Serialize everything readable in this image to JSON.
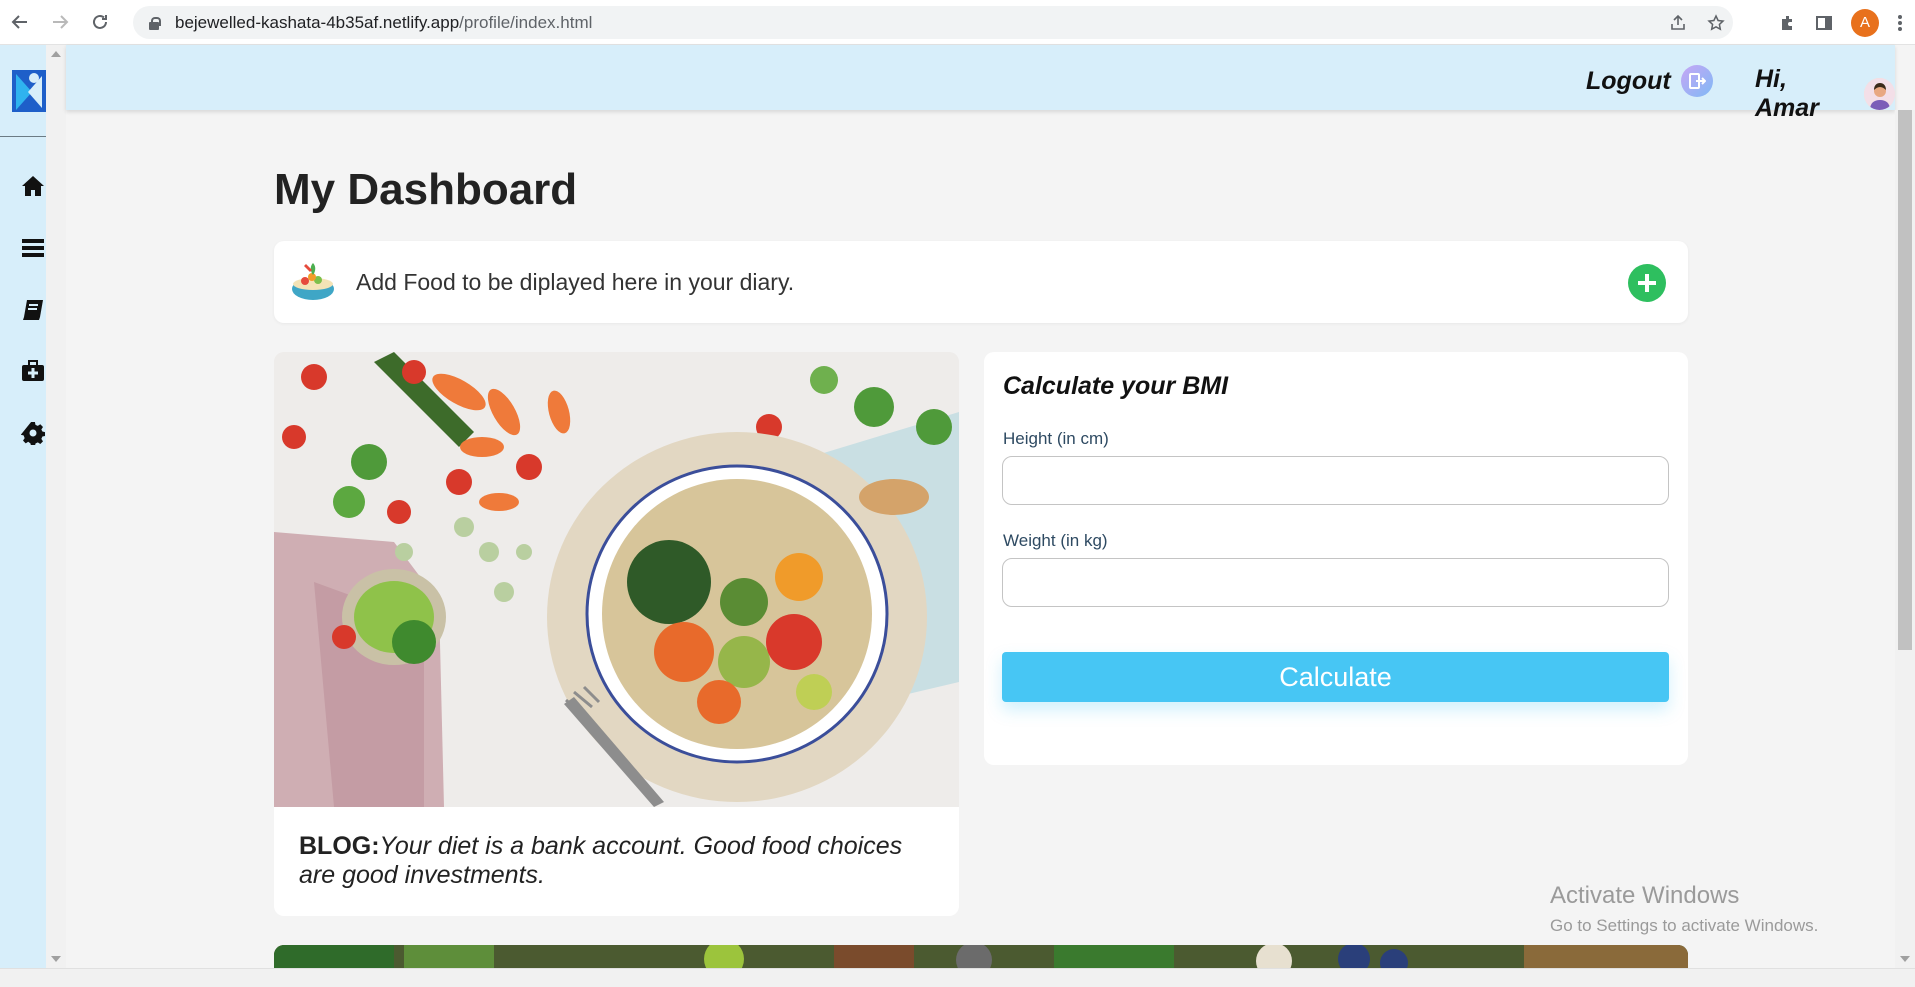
{
  "browser": {
    "url_host": "bejewelled-kashata-4b35af.netlify.app",
    "url_path": "/profile/index.html",
    "profile_initial": "A"
  },
  "header": {
    "logout_label": "Logout",
    "greeting": "Hi, Amar"
  },
  "sidebar": {
    "items": [
      {
        "name": "home",
        "icon": "home-icon"
      },
      {
        "name": "menu",
        "icon": "menu-icon"
      },
      {
        "name": "diary",
        "icon": "book-icon"
      },
      {
        "name": "medical",
        "icon": "medical-kit-icon"
      },
      {
        "name": "settings",
        "icon": "gear-icon"
      }
    ]
  },
  "main": {
    "title": "My Dashboard",
    "food_prompt": "Add Food to be diplayed here in your diary.",
    "blog": {
      "prefix": "BLOG:",
      "text": "Your diet is a bank account. Good food choices are good investments."
    },
    "bmi": {
      "title": "Calculate your BMI",
      "height_label": "Height (in cm)",
      "height_value": "",
      "weight_label": "Weight (in kg)",
      "weight_value": "",
      "button_label": "Calculate"
    }
  },
  "watermark": {
    "line1": "Activate Windows",
    "line2": "Go to Settings to activate Windows."
  },
  "colors": {
    "sidebar_bg": "#d7eefa",
    "accent": "#47c6f4",
    "add_green": "#2ebf5f"
  }
}
